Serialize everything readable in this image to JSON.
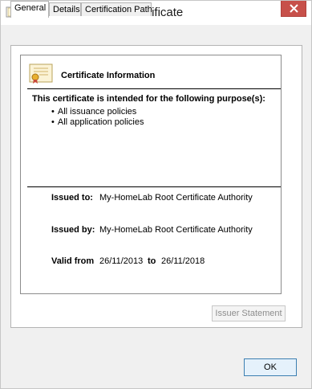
{
  "window": {
    "title": "Certificate"
  },
  "tabs": [
    {
      "label": "General",
      "active": true
    },
    {
      "label": "Details",
      "active": false
    },
    {
      "label": "Certification Path",
      "active": false
    }
  ],
  "info": {
    "title": "Certificate Information",
    "purpose_heading": "This certificate is intended for the following purpose(s):",
    "purposes": [
      "All issuance policies",
      "All application policies"
    ],
    "issued_to_label": "Issued to:",
    "issued_to_value": "My-HomeLab Root Certificate Authority",
    "issued_by_label": "Issued by:",
    "issued_by_value": "My-HomeLab Root Certificate Authority",
    "valid_from_label": "Valid from",
    "valid_from": "26/11/2013",
    "valid_to_label": "to",
    "valid_to": "26/11/2018"
  },
  "buttons": {
    "issuer_statement": "Issuer Statement",
    "ok": "OK"
  },
  "colors": {
    "close_button": "#c7504a",
    "ok_border": "#3c7fb1",
    "ok_fill": "#e5f1fb"
  }
}
